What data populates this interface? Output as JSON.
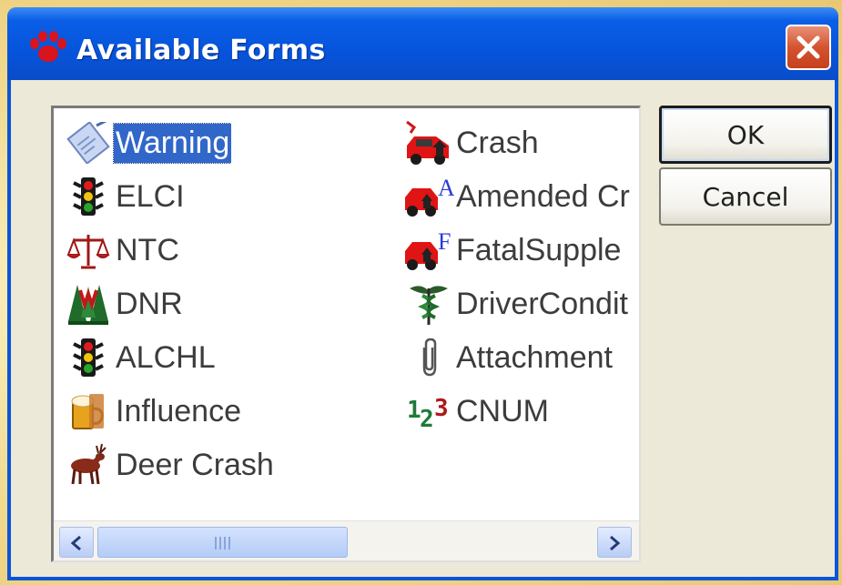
{
  "window": {
    "title": "Available Forms",
    "title_icon": "paw-print-icon",
    "close_icon": "close-icon"
  },
  "forms": {
    "left_column": [
      {
        "label": "Warning",
        "icon": "warning-clipboard-icon",
        "selected": true
      },
      {
        "label": "ELCI",
        "icon": "traffic-light-icon"
      },
      {
        "label": "NTC",
        "icon": "scales-icon"
      },
      {
        "label": "DNR",
        "icon": "trees-icon"
      },
      {
        "label": "ALCHL",
        "icon": "traffic-light-icon"
      },
      {
        "label": "Influence",
        "icon": "beer-mug-icon"
      },
      {
        "label": "Deer Crash",
        "icon": "deer-icon"
      }
    ],
    "right_column": [
      {
        "label": "Crash",
        "icon": "car-crash-icon"
      },
      {
        "label": "Amended Cr",
        "icon": "car-crash-amended-icon"
      },
      {
        "label": "FatalSupple",
        "icon": "car-crash-fatal-icon"
      },
      {
        "label": "DriverCondit",
        "icon": "caduceus-icon"
      },
      {
        "label": "Attachment",
        "icon": "paperclip-icon"
      },
      {
        "label": "CNUM",
        "icon": "numbers-123-icon"
      }
    ]
  },
  "scrollbar": {
    "left_arrow": "chevron-left-icon",
    "right_arrow": "chevron-right-icon",
    "position_fraction": 0.0
  },
  "buttons": {
    "ok_label": "OK",
    "cancel_label": "Cancel"
  },
  "colors": {
    "titlebar": "#0654dc",
    "selection": "#3167c9",
    "close_button": "#d5532f",
    "dialog_face": "#ece9d8"
  }
}
